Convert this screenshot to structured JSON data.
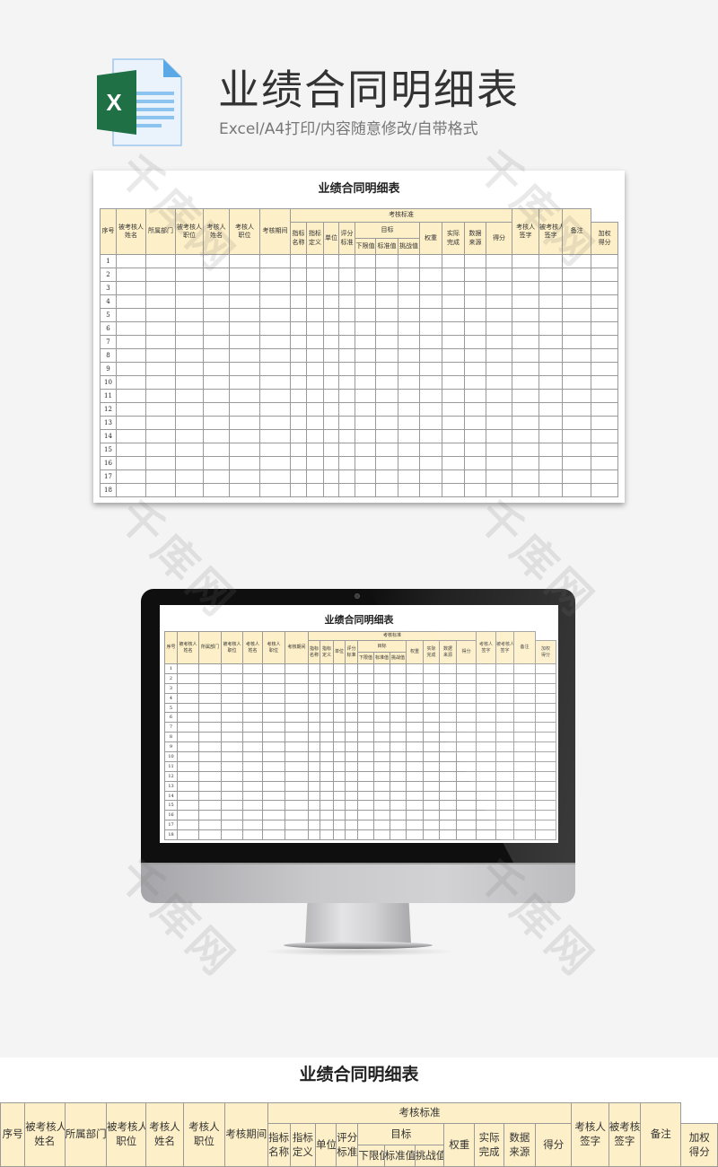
{
  "header": {
    "title": "业绩合同明细表",
    "subtitle": "Excel/A4打印/内容随意修改/自带格式",
    "file_icon": "excel-file-icon",
    "file_icon_letter": "X",
    "brand_color": "#1f7145"
  },
  "sheet": {
    "title": "业绩合同明细表",
    "header_fill": "#fdefc7",
    "columns": {
      "seq": "序号",
      "assessee_name": [
        "被考核人",
        "姓名"
      ],
      "department": "所属部门",
      "assessee_position": [
        "被考核人",
        "职位"
      ],
      "assessor_name": [
        "考核人",
        "姓名"
      ],
      "assessor_position": [
        "考核人",
        "职位"
      ],
      "period": "考核期间",
      "criteria_group": "考核标准",
      "indicator_name": [
        "指标",
        "名称"
      ],
      "indicator_def": [
        "指标",
        "定义"
      ],
      "unit": "单位",
      "scoring_standard": [
        "评分",
        "标准"
      ],
      "target_group": "目标",
      "lower_limit": "下限值",
      "standard_value": "标准值",
      "challenge_value": "挑战值",
      "weight": "权重",
      "actual": [
        "实际",
        "完成"
      ],
      "data_source": [
        "数据",
        "来源"
      ],
      "score": "得分",
      "weighted_score": [
        "加权",
        "得分"
      ],
      "assessor_sign": [
        "考核人",
        "签字"
      ],
      "assessee_sign": [
        "被考核人",
        "签字"
      ],
      "remarks": "备注"
    },
    "rows": [
      "1",
      "2",
      "3",
      "4",
      "5",
      "6",
      "7",
      "8",
      "9",
      "10",
      "11",
      "12",
      "13",
      "14",
      "15",
      "16",
      "17",
      "18"
    ]
  },
  "watermark": "千库网"
}
